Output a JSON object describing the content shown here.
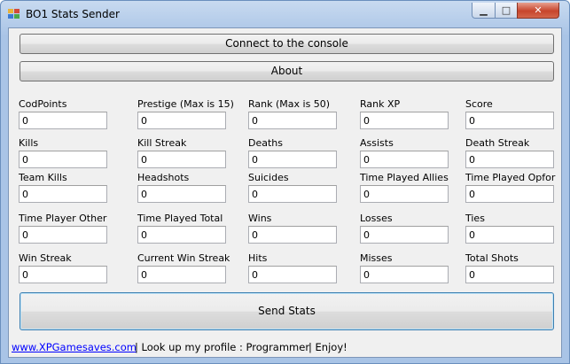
{
  "window": {
    "title": "BO1 Stats Sender",
    "minimize_glyph": "▁",
    "maximize_glyph": "□",
    "close_glyph": "✕"
  },
  "buttons": {
    "connect": "Connect to the console",
    "about": "About",
    "send": "Send Stats"
  },
  "fields": [
    {
      "label": "CodPoints",
      "value": "0"
    },
    {
      "label": "Prestige (Max is 15)",
      "value": "0"
    },
    {
      "label": "Rank (Max is 50)",
      "value": "0"
    },
    {
      "label": "Rank XP",
      "value": "0"
    },
    {
      "label": "Score",
      "value": "0"
    },
    {
      "label": "Kills",
      "value": "0"
    },
    {
      "label": "Kill Streak",
      "value": "0"
    },
    {
      "label": "Deaths",
      "value": "0"
    },
    {
      "label": "Assists",
      "value": "0"
    },
    {
      "label": "Death Streak",
      "value": "0"
    },
    {
      "label": "Team Kills",
      "value": "0"
    },
    {
      "label": "Headshots",
      "value": "0"
    },
    {
      "label": "Suicides",
      "value": "0"
    },
    {
      "label": "Time Played Allies",
      "value": "0"
    },
    {
      "label": "Time Played Opfor",
      "value": "0"
    },
    {
      "label": "Time Player Other",
      "value": "0"
    },
    {
      "label": "Time Played Total",
      "value": "0"
    },
    {
      "label": "Wins",
      "value": "0"
    },
    {
      "label": "Losses",
      "value": "0"
    },
    {
      "label": "Ties",
      "value": "0"
    },
    {
      "label": "Win Streak",
      "value": "0"
    },
    {
      "label": "Current Win Streak",
      "value": "0"
    },
    {
      "label": "Hits",
      "value": "0"
    },
    {
      "label": "Misses",
      "value": "0"
    },
    {
      "label": "Total Shots",
      "value": "0"
    }
  ],
  "status": {
    "link": "www.XPGamesaves.com",
    "profile": "|  Look up my profile : Programmer",
    "enjoy": "|  Enjoy!"
  }
}
